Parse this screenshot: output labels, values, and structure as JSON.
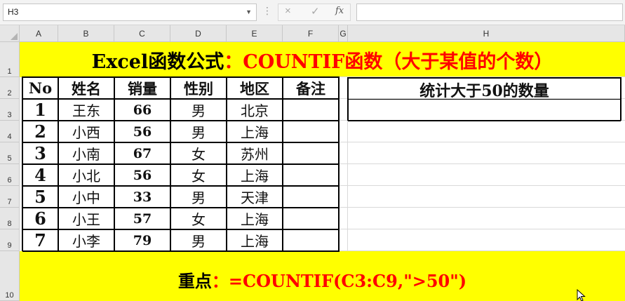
{
  "formula_bar": {
    "name_box": "H3",
    "cancel_icon": "×",
    "enter_icon": "✓",
    "fx_label": "fx",
    "formula": ""
  },
  "columns": [
    "A",
    "B",
    "C",
    "D",
    "E",
    "F",
    "G",
    "H"
  ],
  "rows": [
    "1",
    "2",
    "3",
    "4",
    "5",
    "6",
    "7",
    "8",
    "9",
    "10"
  ],
  "title": {
    "main": "Excel函数公式",
    "rest": "：COUNTIF函数（大于某值的个数）"
  },
  "table": {
    "headers": [
      "No",
      "姓名",
      "销量",
      "性别",
      "地区",
      "备注"
    ],
    "rows": [
      [
        "1",
        "王东",
        "66",
        "男",
        "北京",
        ""
      ],
      [
        "2",
        "小西",
        "56",
        "男",
        "上海",
        ""
      ],
      [
        "3",
        "小南",
        "67",
        "女",
        "苏州",
        ""
      ],
      [
        "4",
        "小北",
        "56",
        "女",
        "上海",
        ""
      ],
      [
        "5",
        "小中",
        "33",
        "男",
        "天津",
        ""
      ],
      [
        "6",
        "小王",
        "57",
        "女",
        "上海",
        ""
      ],
      [
        "7",
        "小李",
        "79",
        "男",
        "上海",
        ""
      ]
    ]
  },
  "stat": {
    "title": "统计大于50的数量",
    "value": ""
  },
  "bottom": {
    "label": "重点",
    "formula": "：=COUNTIF(C3:C9,\">50\")"
  },
  "colors": {
    "highlight": "#ffff00",
    "accent_red": "#ff0000"
  }
}
